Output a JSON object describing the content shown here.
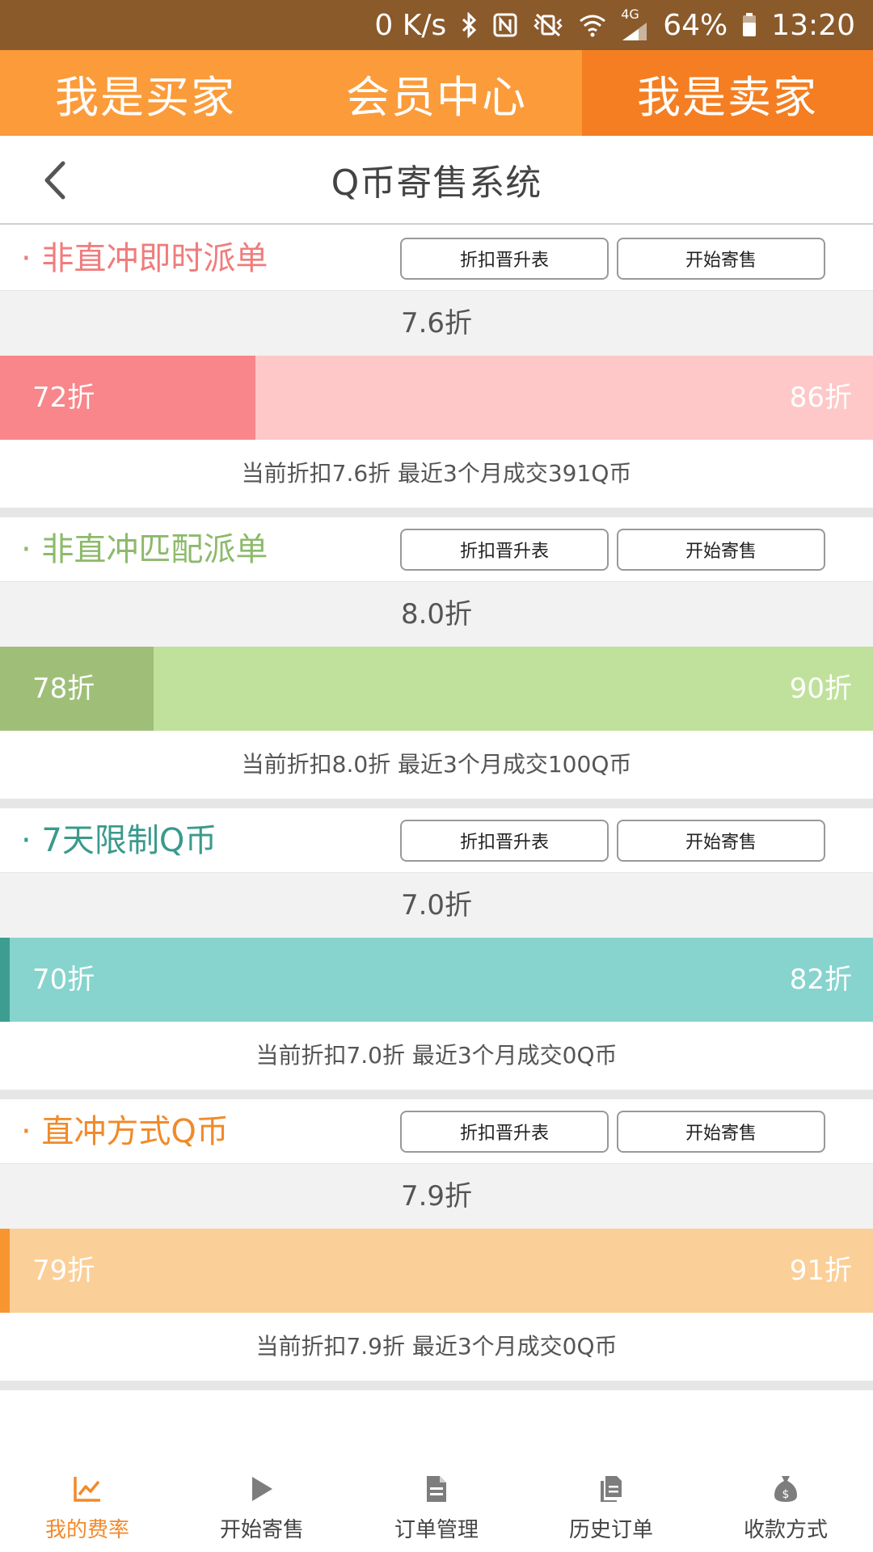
{
  "status_bar": {
    "speed": "0 K/s",
    "network": "4G",
    "battery": "64%",
    "time": "13:20",
    "icons": [
      "bluetooth-icon",
      "nfc-icon",
      "vibrate-icon",
      "wifi-icon",
      "signal-icon",
      "battery-icon"
    ]
  },
  "top_tabs": [
    {
      "label": "我是买家"
    },
    {
      "label": "会员中心"
    },
    {
      "label": "我是卖家"
    }
  ],
  "header": {
    "title": "Q币寄售系统",
    "back_icon": "chevron-left-icon"
  },
  "sections": [
    {
      "name": "· 非直冲即时派单",
      "name_color": "#f07c7c",
      "btn_table": "折扣晋升表",
      "btn_sell": "开始寄售",
      "value": "7.6折",
      "min_label": "72折",
      "max_label": "86折",
      "fill_fraction": 0.293,
      "bar_fill_color": "#f8868a",
      "bar_bg_color": "#fec8c8",
      "info": "当前折扣7.6折  最近3个月成交391Q币"
    },
    {
      "name": "· 非直冲匹配派单",
      "name_color": "#8cba6b",
      "btn_table": "折扣晋升表",
      "btn_sell": "开始寄售",
      "value": "8.0折",
      "min_label": "78折",
      "max_label": "90折",
      "fill_fraction": 0.176,
      "bar_fill_color": "#9fbf78",
      "bar_bg_color": "#c0e19c",
      "info": "当前折扣8.0折  最近3个月成交100Q币"
    },
    {
      "name": "· 7天限制Q币",
      "name_color": "#3a9a8c",
      "btn_table": "折扣晋升表",
      "btn_sell": "开始寄售",
      "value": "7.0折",
      "min_label": "70折",
      "max_label": "82折",
      "fill_fraction": 0.0,
      "bar_fill_color": "#3d9d91",
      "bar_bg_color": "#86d4cd",
      "info": "当前折扣7.0折  最近3个月成交0Q币"
    },
    {
      "name": "· 直冲方式Q币",
      "name_color": "#f08a2a",
      "btn_table": "折扣晋升表",
      "btn_sell": "开始寄售",
      "value": "7.9折",
      "min_label": "79折",
      "max_label": "91折",
      "fill_fraction": 0.0,
      "bar_fill_color": "#f7962f",
      "bar_bg_color": "#fbcf98",
      "info": "当前折扣7.9折  最近3个月成交0Q币"
    }
  ],
  "bottom_nav": [
    {
      "label": "我的费率",
      "icon": "chart-icon"
    },
    {
      "label": "开始寄售",
      "icon": "play-icon"
    },
    {
      "label": "订单管理",
      "icon": "document-icon"
    },
    {
      "label": "历史订单",
      "icon": "copy-icon"
    },
    {
      "label": "收款方式",
      "icon": "money-bag-icon"
    }
  ],
  "colors": {
    "status_bar": "#8a5a2b",
    "tab_bar": "#fb9b3a",
    "tab_active": "#f47e21",
    "nav_active": "#f3892a"
  }
}
